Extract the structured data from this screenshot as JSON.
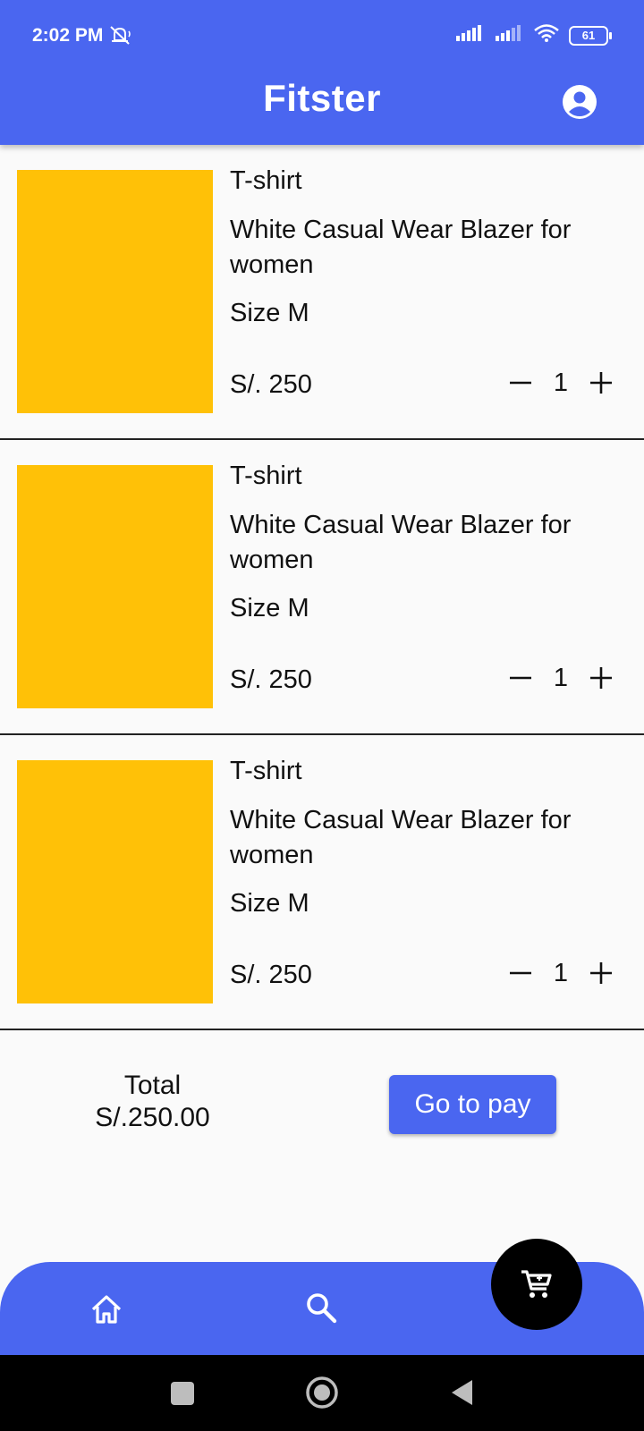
{
  "status_bar": {
    "time": "2:02 PM",
    "battery": "61"
  },
  "header": {
    "title": "Fitster",
    "profile_icon": "account-circle-icon"
  },
  "colors": {
    "primary": "#4a66f0",
    "thumbnail": "#ffc107",
    "fab": "#000000"
  },
  "cart": {
    "items": [
      {
        "category": "T-shirt",
        "name": "White Casual Wear Blazer for women",
        "size": "Size M",
        "price": "S/. 250",
        "quantity": "1"
      },
      {
        "category": "T-shirt",
        "name": "White Casual Wear Blazer for women",
        "size": "Size M",
        "price": "S/. 250",
        "quantity": "1"
      },
      {
        "category": "T-shirt",
        "name": "White Casual Wear Blazer for women",
        "size": "Size M",
        "price": "S/. 250",
        "quantity": "1"
      }
    ]
  },
  "summary": {
    "total_label": "Total",
    "total_amount": "S/.250.00",
    "pay_button": "Go to pay"
  },
  "bottom_nav": {
    "items": [
      "home-icon",
      "search-icon",
      "cart-icon"
    ]
  }
}
